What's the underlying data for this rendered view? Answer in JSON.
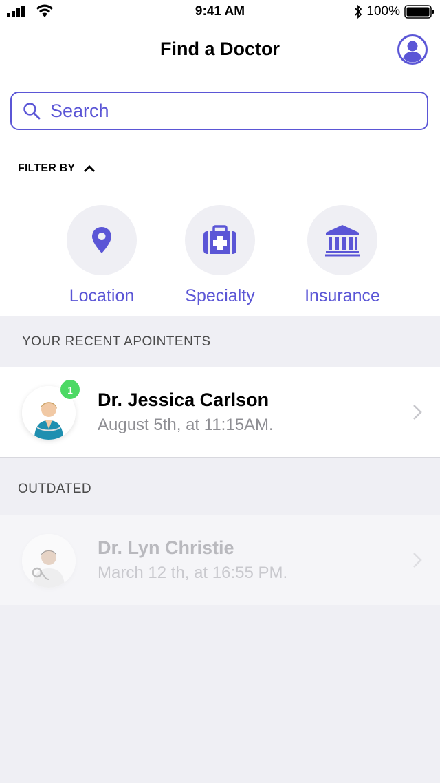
{
  "status_bar": {
    "time": "9:41 AM",
    "battery": "100%"
  },
  "nav": {
    "title": "Find a Doctor"
  },
  "search": {
    "placeholder": "Search"
  },
  "filter": {
    "header": "FILTER BY",
    "options": [
      {
        "label": "Location",
        "icon": "location-pin-icon"
      },
      {
        "label": "Specialty",
        "icon": "medical-kit-icon"
      },
      {
        "label": "Insurance",
        "icon": "bank-building-icon"
      }
    ]
  },
  "recent": {
    "header": "YOUR RECENT APOINTENTS",
    "items": [
      {
        "name": "Dr. Jessica Carlson",
        "time": "August 5th, at 11:15AM.",
        "badge": "1"
      }
    ]
  },
  "outdated": {
    "header": "OUTDATED",
    "items": [
      {
        "name": "Dr. Lyn Christie",
        "time": "March 12 th, at 16:55 PM."
      }
    ]
  },
  "colors": {
    "accent": "#5b56d6",
    "badge": "#4cd964",
    "background": "#efeff4"
  }
}
